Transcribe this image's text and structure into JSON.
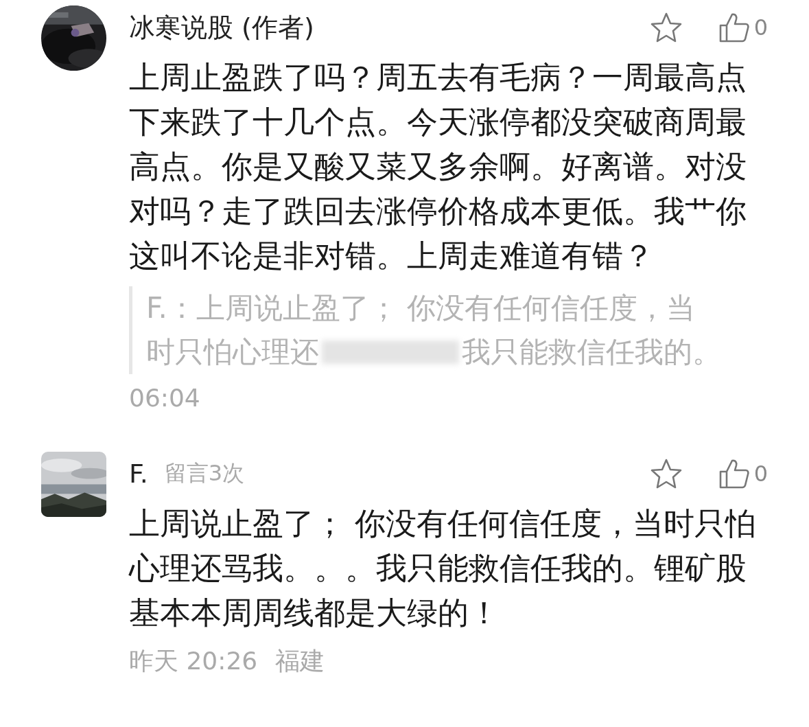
{
  "comments": [
    {
      "round_avatar": true,
      "name": "冰寒说股 (作者)",
      "like_count": "0",
      "text": "上周止盈跌了吗？周五去有毛病？一周最高点下来跌了十几个点。今天涨停都没突破商周最高点。你是又酸又菜又多余啊。好离谱。对没对吗？走了跌回去涨停价格成本更低。我艹你这叫不论是非对错。上周走难道有错？",
      "quote": {
        "line_1": "F.：上周说止盈了； 你没有任何信任度，当",
        "line_2_before_blur": "时只怕心理还",
        "line_2_after_blur": "我只能救信任我的。"
      },
      "time": "06:04"
    },
    {
      "round_avatar": false,
      "name": "F.",
      "badge": "留言3次",
      "like_count": "0",
      "text": "上周说止盈了； 你没有任何信任度，当时只怕心理还骂我。。。我只能救信任我的。锂矿股基本本周周线都是大绿的！",
      "time": "昨天 20:26",
      "location": "福建"
    }
  ]
}
